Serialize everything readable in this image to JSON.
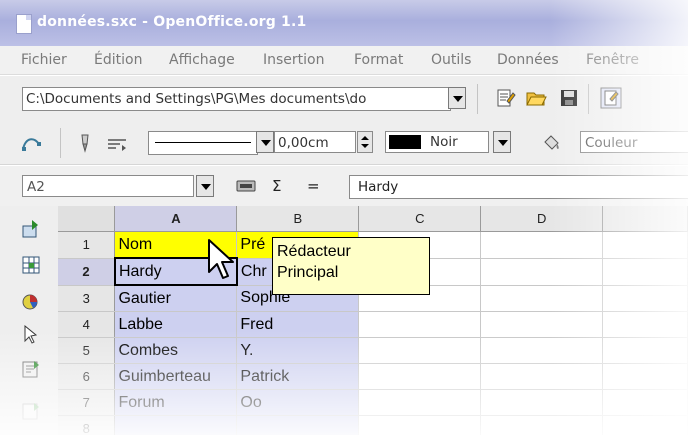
{
  "window": {
    "title": "données.sxc - OpenOffice.org 1.1"
  },
  "menu": [
    {
      "label": "Fichier"
    },
    {
      "label": "Édition"
    },
    {
      "label": "Affichage"
    },
    {
      "label": "Insertion"
    },
    {
      "label": "Format"
    },
    {
      "label": "Outils"
    },
    {
      "label": "Données"
    },
    {
      "label": "Fenêtre"
    }
  ],
  "toolbar": {
    "path": "C:\\Documents and Settings\\PG\\Mes documents\\do",
    "line_width": "0,00cm",
    "line_color": "Noir",
    "line_swatch_color": "#000000",
    "fill_style": "Couleur"
  },
  "formula_bar": {
    "name_box": "A2",
    "sum_symbol": "Σ",
    "equals_symbol": "=",
    "content": "Hardy"
  },
  "grid": {
    "columns": [
      "A",
      "B",
      "C",
      "D"
    ],
    "selected_column": "A",
    "rows": [
      {
        "num": "1",
        "a": "Nom",
        "b": "Pré"
      },
      {
        "num": "2",
        "a": "Hardy",
        "b": "Chr"
      },
      {
        "num": "3",
        "a": "Gautier",
        "b": "Sophie"
      },
      {
        "num": "4",
        "a": "Labbe",
        "b": "Fred"
      },
      {
        "num": "5",
        "a": "Combes",
        "b": "Y."
      },
      {
        "num": "6",
        "a": "Guimberteau",
        "b": "Patrick"
      },
      {
        "num": "7",
        "a": "Forum",
        "b": "Oo"
      },
      {
        "num": "8",
        "a": "",
        "b": ""
      }
    ]
  },
  "tooltip": {
    "line1": "Rédacteur",
    "line2": "Principal"
  },
  "colors": {
    "header_highlight": "#ffff00",
    "selection": "#cdd0f0",
    "tooltip_bg": "#ffffc8",
    "titlebar": "#a9afdd"
  }
}
